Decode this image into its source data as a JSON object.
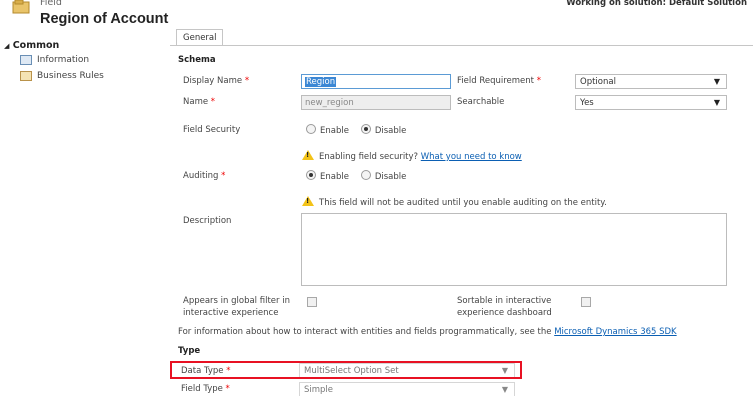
{
  "header": {
    "subtitle": "Field",
    "title": "Region of Account",
    "solution": "Working on solution: Default Solution"
  },
  "nav": {
    "section": "Common",
    "items": [
      {
        "label": "Information",
        "icon": "form-icon"
      },
      {
        "label": "Business Rules",
        "icon": "business-rules-icon"
      }
    ]
  },
  "tabs": [
    {
      "label": "General"
    }
  ],
  "schema": {
    "heading": "Schema",
    "display_name": {
      "label": "Display Name",
      "value": "Region"
    },
    "name": {
      "label": "Name",
      "value": "new_region"
    },
    "field_requirement": {
      "label": "Field Requirement",
      "value": "Optional"
    },
    "searchable": {
      "label": "Searchable",
      "value": "Yes"
    },
    "field_security": {
      "label": "Field Security",
      "options": [
        "Enable",
        "Disable"
      ],
      "selected": "Disable"
    },
    "security_warning": {
      "text": "Enabling field security?",
      "link": "What you need to know"
    },
    "auditing": {
      "label": "Auditing",
      "options": [
        "Enable",
        "Disable"
      ],
      "selected": "Enable"
    },
    "audit_warning": "This field will not be audited until you enable auditing on the entity.",
    "description": {
      "label": "Description",
      "value": ""
    },
    "global_filter": {
      "label_line1": "Appears in global filter in",
      "label_line2": "interactive experience",
      "checked": false
    },
    "sortable": {
      "label_line1": "Sortable in interactive",
      "label_line2": "experience dashboard",
      "checked": false
    },
    "info_text": "For information about how to interact with entities and fields programmatically, see the",
    "info_link": "Microsoft Dynamics 365 SDK"
  },
  "type": {
    "heading": "Type",
    "data_type": {
      "label": "Data Type",
      "value": "MultiSelect Option Set"
    },
    "field_type": {
      "label": "Field Type",
      "value": "Simple"
    }
  },
  "colors": {
    "required": "#ee0000",
    "highlight": "#e81123",
    "link": "#0b5fb3",
    "warning": "#f3c318"
  }
}
